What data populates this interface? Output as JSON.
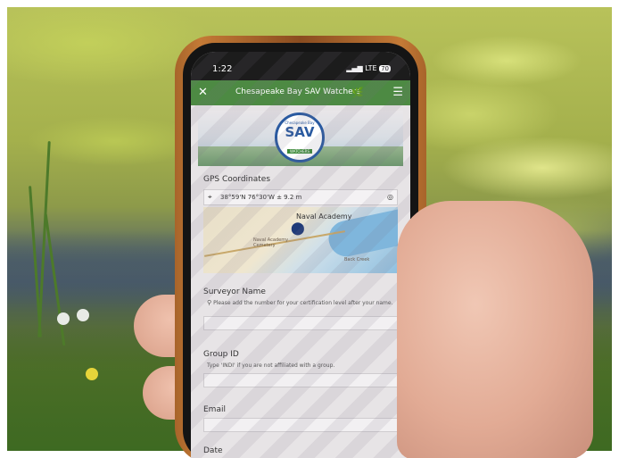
{
  "status": {
    "time": "1:22",
    "signal": "LTE",
    "battery": "70"
  },
  "header": {
    "title": "Chesapeake Bay SAV Watchers"
  },
  "badge": {
    "top": "Chesapeake Bay",
    "main": "SAV",
    "sub": "WATCHERS"
  },
  "form": {
    "gps_label": "GPS Coordinates",
    "gps_value": "38°59'N 76°30'W ± 9.2 m",
    "map_label": "Naval Academy",
    "map_place": "Naval Academy Cemetery",
    "map_place_2": "Back Creek",
    "surveyor_label": "Surveyor Name",
    "surveyor_hint": "Please add the number for your certification level after your name.",
    "group_label": "Group ID",
    "group_hint": "Type 'INDI' if you are not affiliated with a group.",
    "email_label": "Email",
    "date_label": "Date"
  }
}
